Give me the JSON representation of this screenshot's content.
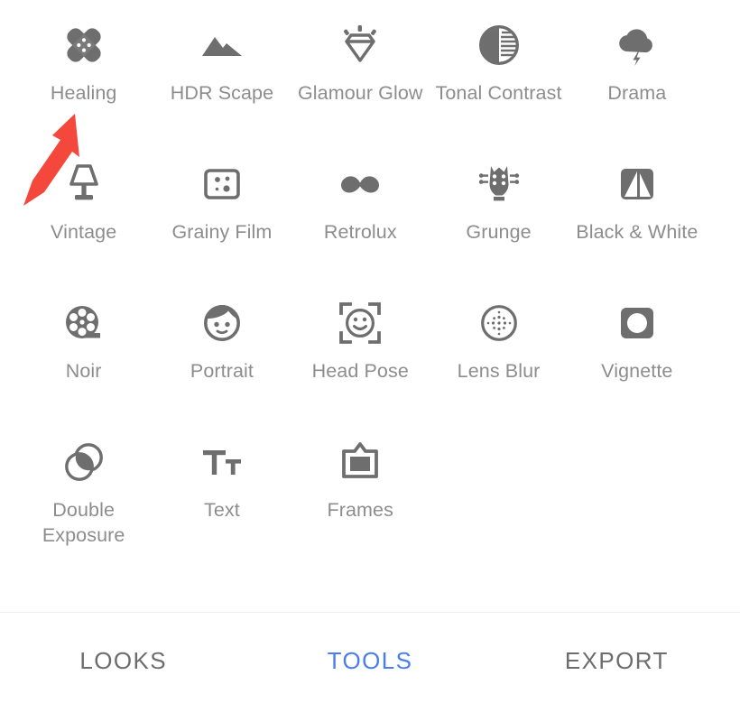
{
  "app": {
    "screen_name": "Tools",
    "background_color": "#ffffff",
    "icon_color": "#6e6e6e",
    "label_color": "#8d8d8d",
    "accent_color": "#4a7ef0",
    "annotation_color": "#f4483c"
  },
  "tools": [
    {
      "label": "Healing",
      "icon": "bandage-cross-icon"
    },
    {
      "label": "HDR Scape",
      "icon": "mountains-icon"
    },
    {
      "label": "Glamour\nGlow",
      "icon": "sparkling-diamond-icon"
    },
    {
      "label": "Tonal\nContrast",
      "icon": "half-shaded-circle-icon"
    },
    {
      "label": "Drama",
      "icon": "storm-cloud-icon"
    },
    {
      "label": "Vintage",
      "icon": "table-lamp-icon"
    },
    {
      "label": "Grainy Film",
      "icon": "grain-square-icon"
    },
    {
      "label": "Retrolux",
      "icon": "moustache-icon"
    },
    {
      "label": "Grunge",
      "icon": "guitar-headstock-icon"
    },
    {
      "label": "Black\n& White",
      "icon": "black-white-square-icon"
    },
    {
      "label": "Noir",
      "icon": "film-reel-icon"
    },
    {
      "label": "Portrait",
      "icon": "face-portrait-icon"
    },
    {
      "label": "Head Pose",
      "icon": "face-brackets-icon"
    },
    {
      "label": "Lens Blur",
      "icon": "dotted-circle-icon"
    },
    {
      "label": "Vignette",
      "icon": "rounded-square-dot-icon"
    },
    {
      "label": "Double\nExposure",
      "icon": "overlapping-circles-icon"
    },
    {
      "label": "Text",
      "icon": "text-tt-icon"
    },
    {
      "label": "Frames",
      "icon": "picture-frame-icon"
    }
  ],
  "bottom_bar": {
    "tabs": [
      {
        "label": "LOOKS",
        "active": false
      },
      {
        "label": "TOOLS",
        "active": true
      },
      {
        "label": "EXPORT",
        "active": false
      }
    ]
  },
  "annotation": {
    "type": "arrow",
    "points_to": "Healing",
    "color": "#f4483c"
  }
}
